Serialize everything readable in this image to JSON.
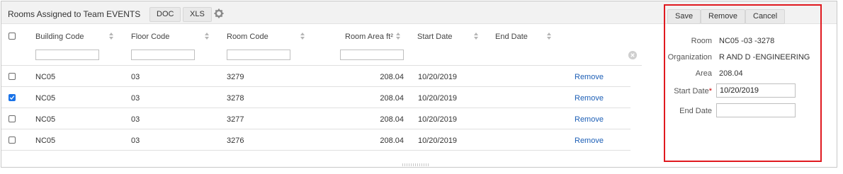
{
  "grid": {
    "title": "Rooms Assigned to Team EVENTS",
    "doc_label": "DOC",
    "xls_label": "XLS",
    "columns": {
      "building_code": "Building Code",
      "floor_code": "Floor Code",
      "room_code": "Room Code",
      "room_area": "Room Area ft²",
      "start_date": "Start Date",
      "end_date": "End Date"
    },
    "rows": [
      {
        "building": "NC05",
        "floor": "03",
        "room": "3279",
        "area": "208.04",
        "start": "10/20/2019",
        "end": "",
        "action": "Remove",
        "checked": false
      },
      {
        "building": "NC05",
        "floor": "03",
        "room": "3278",
        "area": "208.04",
        "start": "10/20/2019",
        "end": "",
        "action": "Remove",
        "checked": true
      },
      {
        "building": "NC05",
        "floor": "03",
        "room": "3277",
        "area": "208.04",
        "start": "10/20/2019",
        "end": "",
        "action": "Remove",
        "checked": false
      },
      {
        "building": "NC05",
        "floor": "03",
        "room": "3276",
        "area": "208.04",
        "start": "10/20/2019",
        "end": "",
        "action": "Remove",
        "checked": false
      }
    ]
  },
  "panel": {
    "save_label": "Save",
    "remove_label": "Remove",
    "cancel_label": "Cancel",
    "room_label": "Room",
    "room_value": "NC05 -03 -3278",
    "organization_label": "Organization",
    "organization_value": "R AND D -ENGINEERING",
    "area_label": "Area",
    "area_value": "208.04",
    "start_date_label": "Start Date",
    "start_date_value": "10/20/2019",
    "end_date_label": "End Date",
    "end_date_value": ""
  },
  "colors": {
    "highlight_border": "#e0191f",
    "link": "#1d5fb6",
    "checkbox_checked": "#1a73e8"
  }
}
